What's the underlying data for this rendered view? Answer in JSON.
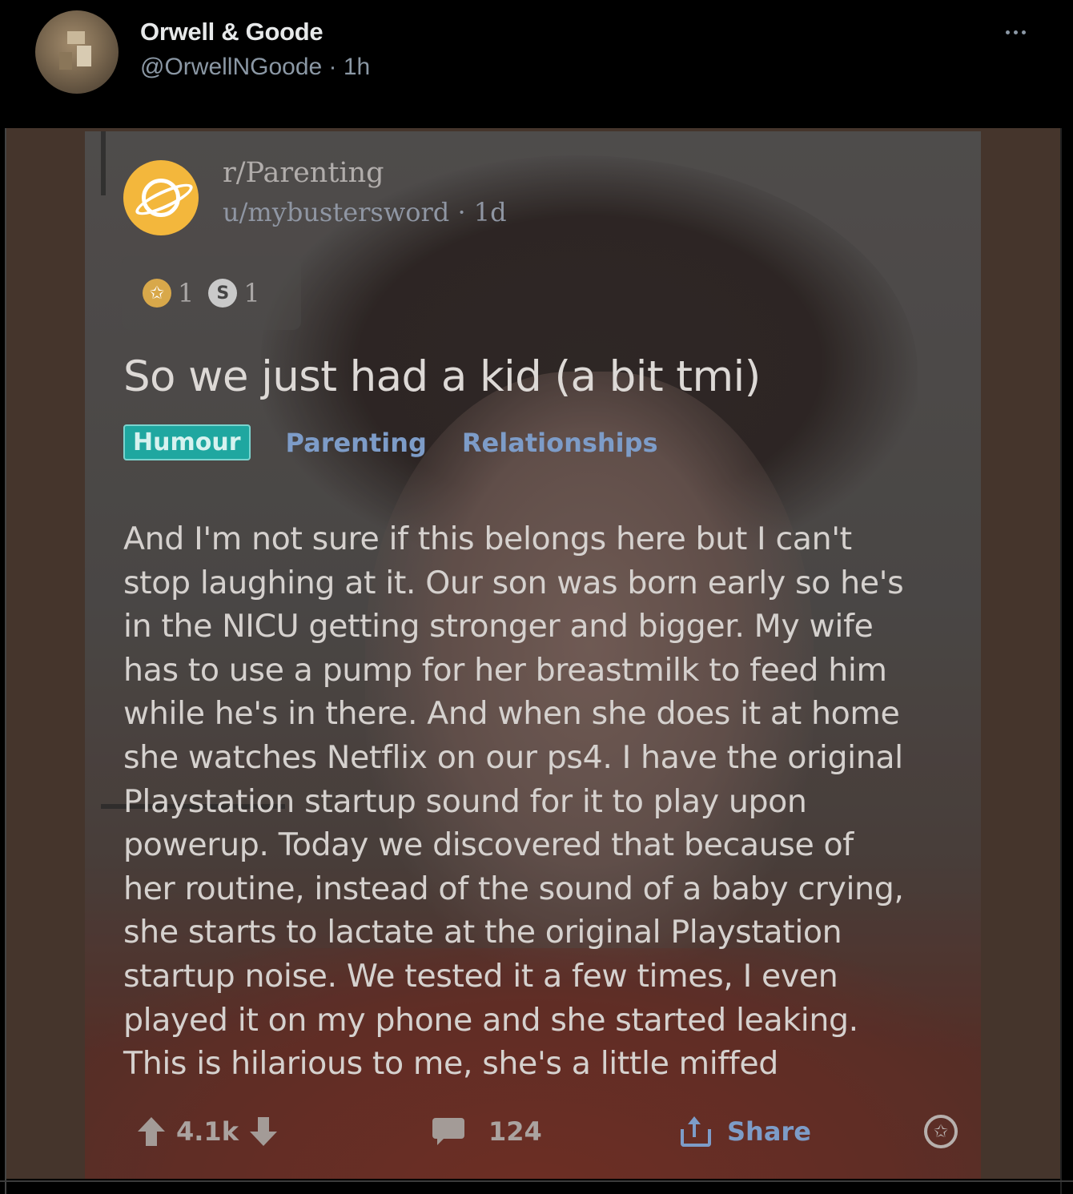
{
  "tweet": {
    "display_name": "Orwell & Goode",
    "handle": "@OrwellNGoode",
    "separator": " · ",
    "time": "1h"
  },
  "post": {
    "subreddit": "r/Parenting",
    "author": "u/mybustersword",
    "author_separator": " · ",
    "age": "1d",
    "awards": [
      {
        "icon": "gold-award-icon",
        "count": "1"
      },
      {
        "icon": "silver-award-icon",
        "count": "1"
      }
    ],
    "title": "So we just had a kid (a bit tmi)",
    "flairs": [
      "Humour",
      "Parenting",
      "Relationships"
    ],
    "body": "And I'm not sure if this belongs here but I can't\nstop laughing at it. Our son was born early so he's\nin the NICU getting stronger and bigger. My wife\nhas to use a pump for her breastmilk to feed him\nwhile he's in there. And when she does it at home\nshe watches Netflix on our ps4. I have the original\nPlaystation startup sound for it to play upon\npowerup. Today we discovered that because of\nher routine, instead of the sound of a baby crying,\nshe starts to lactate at the original Playstation\nstartup noise. We tested it a few times, I even\nplayed it on my phone and she started leaking.\nThis is hilarious to me, she's a little miffed",
    "votes": "4.1k",
    "comments": "124",
    "share_label": "Share"
  },
  "colors": {
    "background": "#000000",
    "name": "#e7e9ea",
    "secondary": "#8b98a5",
    "media_frame": "#45352c",
    "subreddit_icon": "#f3b73c",
    "flair_humour": "#1fa7a0",
    "flair_link": "#7d9cc8"
  }
}
